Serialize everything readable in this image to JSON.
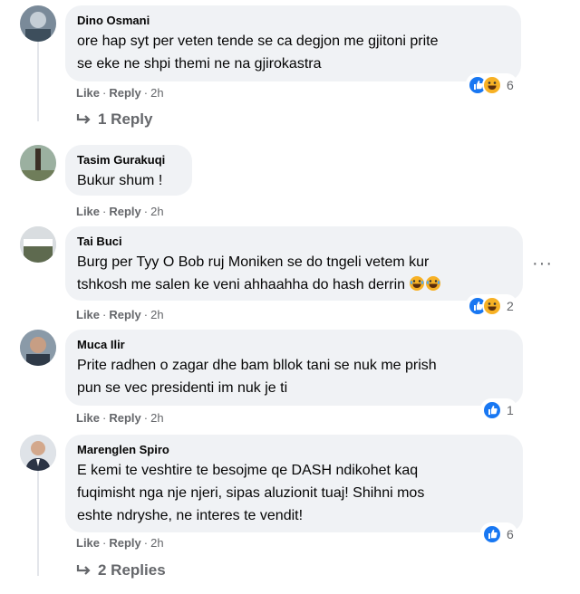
{
  "comments": [
    {
      "author": "Dino Osmani",
      "text": "ore hap syt per veten tende se ca degjon me gjitoni prite\nse eke ne shpi themi ne na gjirokastra",
      "like": "Like",
      "reply": "Reply",
      "time": "2h",
      "reactions": {
        "icons": [
          "like-icon",
          "haha-icon"
        ],
        "count": "6"
      },
      "replies_label": "1 Reply"
    },
    {
      "author": "Tasim Gurakuqi",
      "text": "Bukur shum !",
      "like": "Like",
      "reply": "Reply",
      "time": "2h"
    },
    {
      "author": "Tai Buci",
      "text": "Burg per Tyy O Bob ruj Moniken se do tngeli vetem kur\ntshkosh me salen ke veni ahhaahha do hash derrin",
      "like": "Like",
      "reply": "Reply",
      "time": "2h",
      "reactions": {
        "icons": [
          "like-icon",
          "haha-icon"
        ],
        "count": "2"
      },
      "more": "···"
    },
    {
      "author": "Muca Ilir",
      "text": "Prite radhen o zagar dhe bam bllok tani se nuk me prish\npun se vec presidenti im nuk je ti",
      "like": "Like",
      "reply": "Reply",
      "time": "2h",
      "reactions": {
        "icons": [
          "like-icon"
        ],
        "count": "1"
      }
    },
    {
      "author": "Marenglen Spiro",
      "text": "E kemi te veshtire te besojme qe DASH ndikohet kaq\nfuqimisht nga nje njeri, sipas aluzionit tuaj! Shihni mos\neshte ndryshe, ne interes te vendit!",
      "like": "Like",
      "reply": "Reply",
      "time": "2h",
      "reactions": {
        "icons": [
          "like-icon"
        ],
        "count": "6"
      },
      "replies_label": "2 Replies"
    }
  ],
  "colors": {
    "bubble": "#f0f2f5",
    "secondary_text": "#65676b",
    "like_blue": "#1877f2",
    "haha_yellow": "#f7b125"
  }
}
